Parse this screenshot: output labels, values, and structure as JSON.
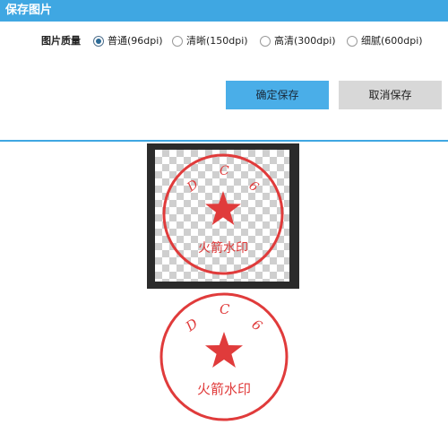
{
  "dialog": {
    "title": "保存图片",
    "quality_label": "图片质量",
    "options": [
      {
        "label": "普通(96dpi)",
        "selected": true
      },
      {
        "label": "清晰(150dpi)",
        "selected": false
      },
      {
        "label": "高清(300dpi)",
        "selected": false
      },
      {
        "label": "细腻(600dpi)",
        "selected": false
      }
    ],
    "confirm_label": "确定保存",
    "cancel_label": "取消保存"
  },
  "stamp": {
    "letters": [
      "D",
      "C",
      "6"
    ],
    "caption": "火箭水印",
    "color": "#e03b3b"
  },
  "colors": {
    "titlebar": "#3fa7e2",
    "confirm_button": "#4aaee8",
    "cancel_button": "#d8d8d8"
  }
}
